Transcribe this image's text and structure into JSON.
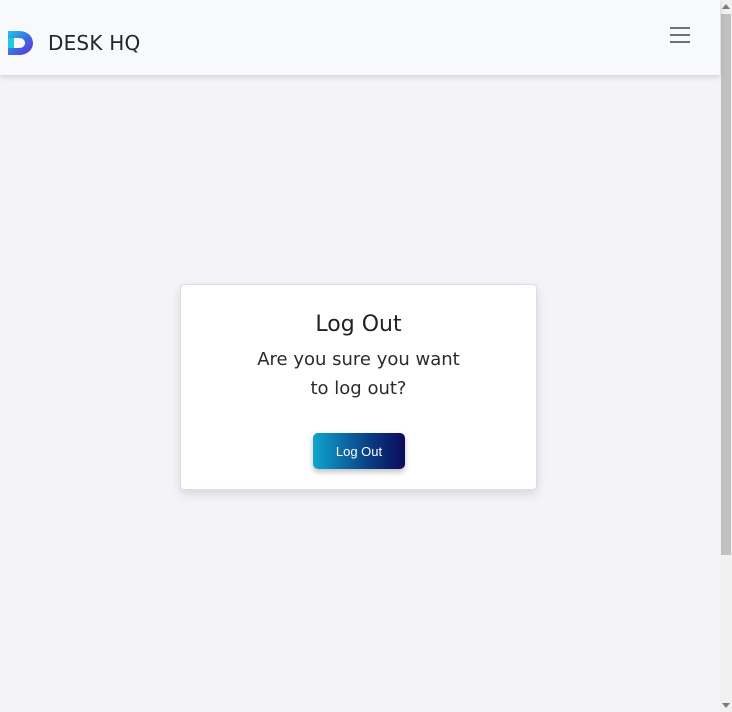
{
  "header": {
    "brand_name": "DESK HQ",
    "logo_icon": "desk-hq-logo-icon",
    "menu_icon": "hamburger-menu-icon"
  },
  "logout_card": {
    "title": "Log Out",
    "message": "Are you sure you want to log out?",
    "button_label": "Log Out"
  },
  "colors": {
    "page_background": "#f4f4f8",
    "navbar_background": "#f8f9fb",
    "button_gradient_start": "#0ea5cc",
    "button_gradient_end": "#0b0a5a",
    "logo_gradient_start": "#1ec8e8",
    "logo_gradient_end": "#6a2bd6"
  }
}
